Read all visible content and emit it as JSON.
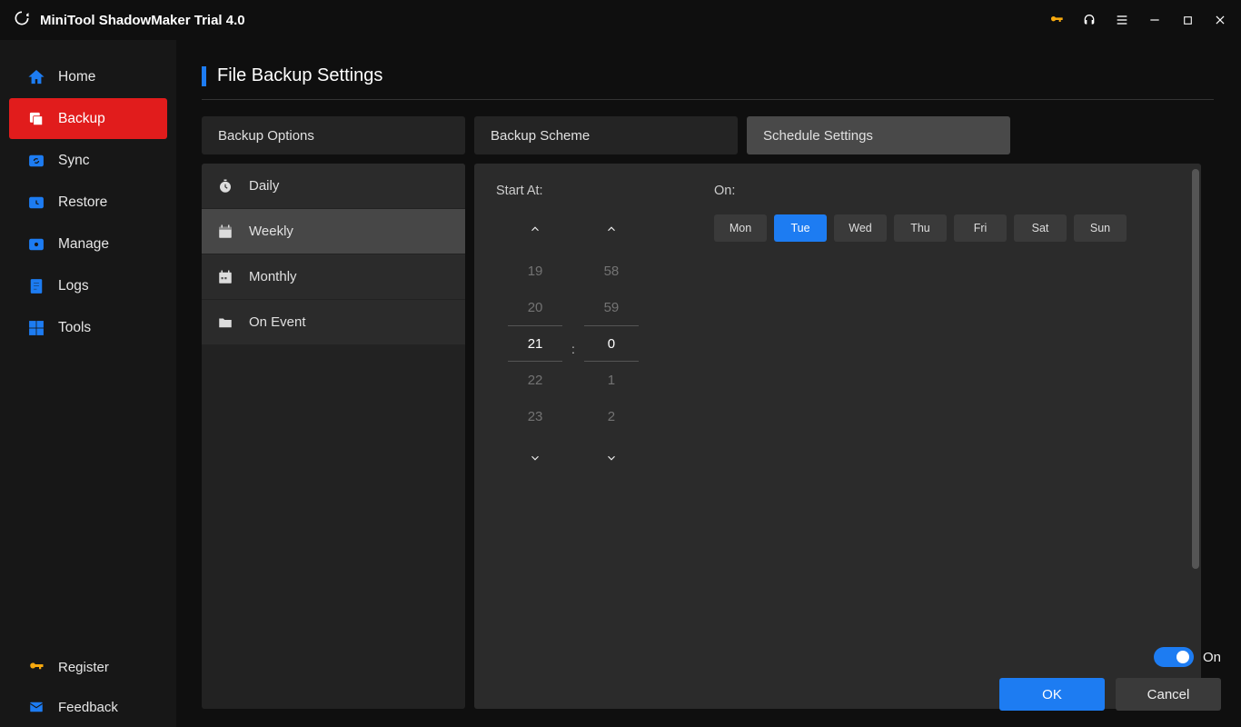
{
  "app": {
    "title": "MiniTool ShadowMaker Trial 4.0"
  },
  "sidebar": {
    "items": [
      {
        "label": "Home"
      },
      {
        "label": "Backup"
      },
      {
        "label": "Sync"
      },
      {
        "label": "Restore"
      },
      {
        "label": "Manage"
      },
      {
        "label": "Logs"
      },
      {
        "label": "Tools"
      }
    ],
    "footer": [
      {
        "label": "Register"
      },
      {
        "label": "Feedback"
      }
    ]
  },
  "page": {
    "title": "File Backup Settings"
  },
  "tabs": {
    "options": "Backup Options",
    "scheme": "Backup Scheme",
    "schedule": "Schedule Settings"
  },
  "schedule_modes": {
    "daily": "Daily",
    "weekly": "Weekly",
    "monthly": "Monthly",
    "on_event": "On Event"
  },
  "schedule": {
    "start_label": "Start At:",
    "on_label": "On:",
    "hours": {
      "vals": [
        "19",
        "20",
        "21",
        "22",
        "23"
      ],
      "selected": "21"
    },
    "minutes": {
      "vals": [
        "58",
        "59",
        "0",
        "1",
        "2"
      ],
      "selected": "0"
    },
    "colon": ":",
    "days": [
      {
        "label": "Mon",
        "active": false
      },
      {
        "label": "Tue",
        "active": true
      },
      {
        "label": "Wed",
        "active": false
      },
      {
        "label": "Thu",
        "active": false
      },
      {
        "label": "Fri",
        "active": false
      },
      {
        "label": "Sat",
        "active": false
      },
      {
        "label": "Sun",
        "active": false
      }
    ]
  },
  "footer_controls": {
    "toggle_label": "On",
    "ok": "OK",
    "cancel": "Cancel"
  }
}
